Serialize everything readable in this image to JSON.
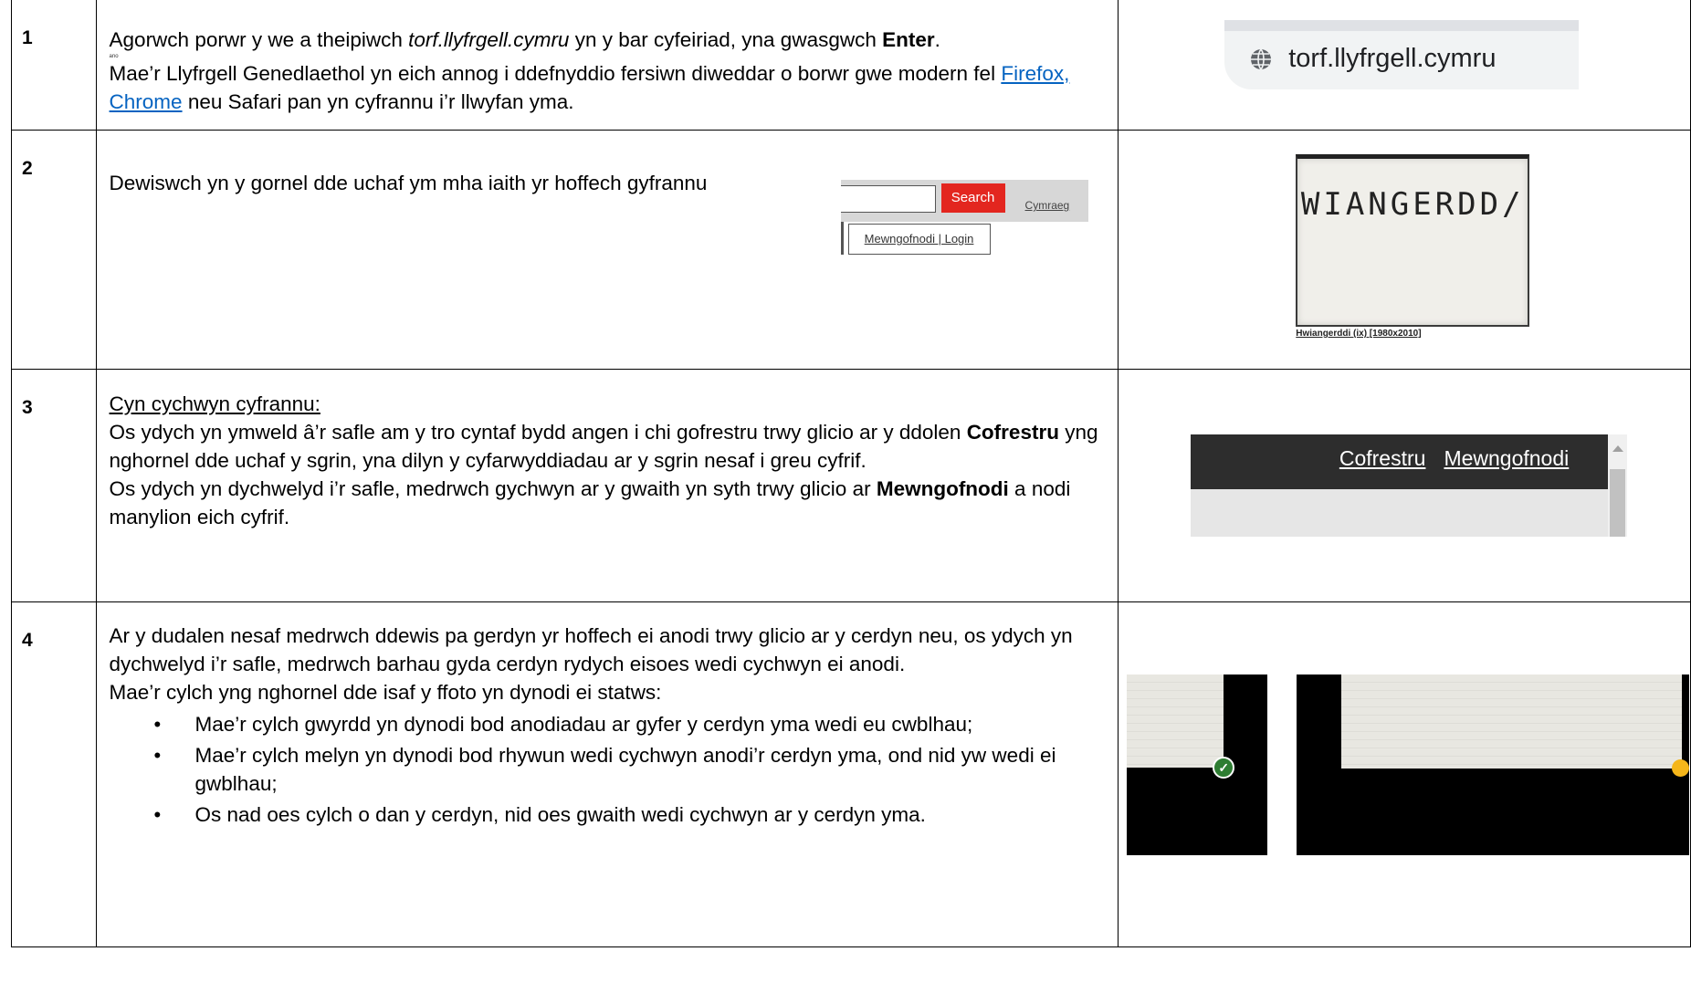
{
  "steps": [
    {
      "number": "1",
      "line1_a": "Agorwch porwr y we a theipiwch ",
      "line1_url": "torf.llyfrgell.cymru",
      "line1_b": " yn y bar cyfeiriad, yna gwasgwch ",
      "line1_key": "Enter",
      "line1_end": ".",
      "tiny_note": "ano",
      "para2_a": "Mae’r Llyfrgell Genedlaethol yn eich annog i ddefnyddio fersiwn diweddar o borwr gwe modern fel ",
      "link_firefox": "Firefox,",
      "link_chrome": "Chrome",
      "para2_b": " neu Safari pan yn cyfrannu i’r llwyfan yma.",
      "image_url_text": "torf.llyfrgell.cymru"
    },
    {
      "number": "2",
      "text": "Dewiswch yn y gornel dde uchaf ym mha iaith yr hoffech gyfrannu",
      "search_button": "Search",
      "language_link": "Cymraeg",
      "login_button": "Mewngofnodi | Login",
      "card_handwriting": "WIANGERDD/",
      "card_caption": "Hwiangerddi (ix) [1980x2010]"
    },
    {
      "number": "3",
      "heading": "Cyn cychwyn cyfrannu:",
      "para1_a": "Os ydych yn ymweld â’r safle am y tro cyntaf bydd angen i chi gofrestru trwy glicio ar y ddolen ",
      "para1_bold": "Cofrestru",
      "para1_b": " yng nghornel dde uchaf y sgrin, yna dilyn y cyfarwyddiadau ar y sgrin nesaf i greu cyfrif.",
      "para2_a": "Os ydych yn dychwelyd i’r safle, medrwch gychwyn ar y gwaith yn syth trwy glicio ar ",
      "para2_bold": "Mewngofnodi",
      "para2_b": " a nodi manylion eich cyfrif.",
      "nav_register": "Cofrestru",
      "nav_login": "Mewngofnodi"
    },
    {
      "number": "4",
      "para1": "Ar y dudalen nesaf medrwch ddewis pa gerdyn yr hoffech ei anodi trwy glicio ar y cerdyn neu, os ydych yn dychwelyd i’r safle, medrwch barhau gyda cerdyn rydych eisoes wedi cychwyn ei anodi.",
      "para2": "Mae’r cylch yng nghornel dde isaf y ffoto yn dynodi ei statws:",
      "bullets": [
        "Mae’r cylch gwyrdd yn dynodi bod anodiadau ar gyfer y cerdyn yma wedi eu cwblhau;",
        "Mae’r cylch melyn yn dynodi bod rhywun wedi cychwyn anodi’r cerdyn yma, ond nid yw wedi ei gwblhau;",
        "Os nad oes cylch o dan y cerdyn, nid oes gwaith wedi cychwyn ar y cerdyn yma."
      ],
      "checkmark": "✓"
    }
  ]
}
